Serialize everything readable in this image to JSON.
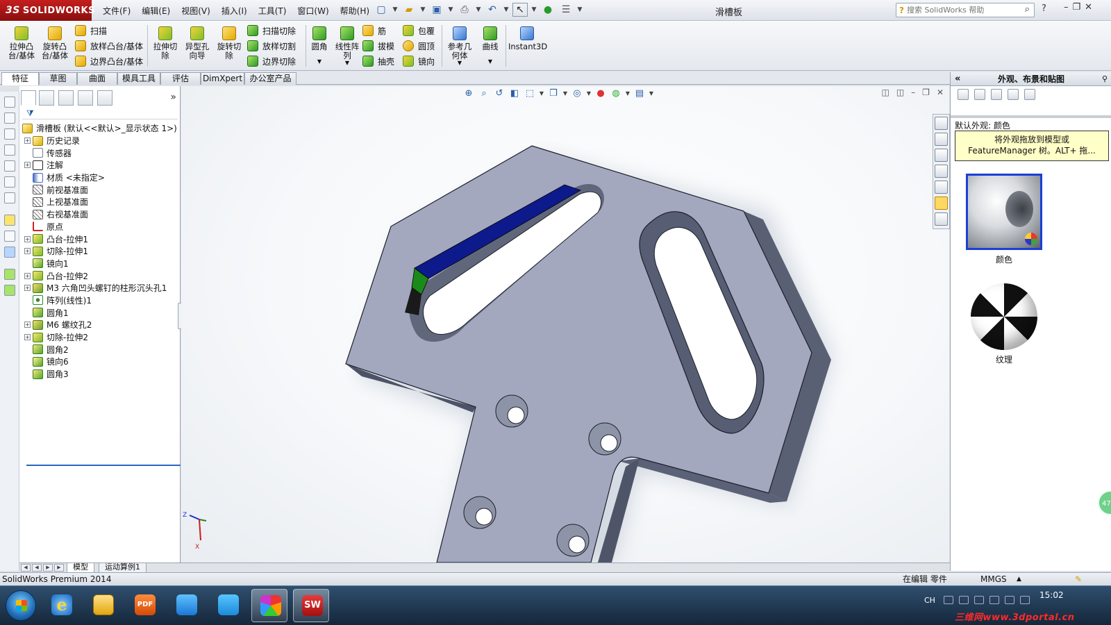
{
  "app": {
    "logo_prefix": "3S",
    "logo_text": "SOLIDWORKS",
    "document_title": "滑槽板"
  },
  "menus": [
    "文件(F)",
    "编辑(E)",
    "视图(V)",
    "插入(I)",
    "工具(T)",
    "窗口(W)",
    "帮助(H)"
  ],
  "search": {
    "placeholder": "搜索 SolidWorks 帮助"
  },
  "command_manager": {
    "big_buttons": [
      {
        "label": "拉伸凸\n台/基体"
      },
      {
        "label": "旋转凸\n台/基体"
      },
      {
        "label": "拉伸切\n除"
      },
      {
        "label": "异型孔\n向导"
      },
      {
        "label": "旋转切\n除"
      },
      {
        "label": "圆角"
      },
      {
        "label": "线性阵\n列"
      },
      {
        "label": "参考几\n何体"
      },
      {
        "label": "曲线"
      },
      {
        "label": "Instant3D"
      }
    ],
    "small_buttons": [
      {
        "label": "扫描"
      },
      {
        "label": "放样凸台/基体"
      },
      {
        "label": "边界凸台/基体"
      },
      {
        "label": "扫描切除"
      },
      {
        "label": "放样切割"
      },
      {
        "label": "边界切除"
      },
      {
        "label": "筋"
      },
      {
        "label": "拔模"
      },
      {
        "label": "抽壳"
      },
      {
        "label": "包覆"
      },
      {
        "label": "圆顶"
      },
      {
        "label": "镜向"
      }
    ]
  },
  "cm_tabs": [
    "特征",
    "草图",
    "曲面",
    "模具工具",
    "评估",
    "DimXpert",
    "办公室产品"
  ],
  "feature_tree": {
    "root": "滑槽板  (默认<<默认>_显示状态 1>)",
    "items": [
      {
        "label": "历史记录",
        "expandable": true
      },
      {
        "label": "传感器",
        "expandable": false
      },
      {
        "label": "注解",
        "expandable": true
      },
      {
        "label": "材质 <未指定>",
        "expandable": false
      },
      {
        "label": "前视基准面",
        "expandable": false
      },
      {
        "label": "上视基准面",
        "expandable": false
      },
      {
        "label": "右视基准面",
        "expandable": false
      },
      {
        "label": "原点",
        "expandable": false
      },
      {
        "label": "凸台-拉伸1",
        "expandable": true
      },
      {
        "label": "切除-拉伸1",
        "expandable": true
      },
      {
        "label": "镜向1",
        "expandable": false
      },
      {
        "label": "凸台-拉伸2",
        "expandable": true
      },
      {
        "label": "M3 六角凹头螺钉的柱形沉头孔1",
        "expandable": true
      },
      {
        "label": "阵列(线性)1",
        "expandable": false
      },
      {
        "label": "圆角1",
        "expandable": false
      },
      {
        "label": "M6 螺纹孔2",
        "expandable": true
      },
      {
        "label": "切除-拉伸2",
        "expandable": true
      },
      {
        "label": "圆角2",
        "expandable": false
      },
      {
        "label": "镜向6",
        "expandable": false
      },
      {
        "label": "圆角3",
        "expandable": false
      }
    ]
  },
  "appearance_pane": {
    "title": "外观、布景和贴图",
    "section_label": "默认外观: 颜色",
    "tooltip": "将外观拖放到模型或\nFeatureManager 树。ALT+ 拖...",
    "swatches": [
      {
        "label": "颜色",
        "selected": true
      },
      {
        "label": "纹理",
        "selected": false
      }
    ]
  },
  "triad": {
    "z": "Z",
    "x": "X"
  },
  "bottom_tabs": [
    "模型",
    "运动算例1"
  ],
  "status": {
    "product": "SolidWorks Premium 2014",
    "mode": "在编辑 零件",
    "units": "MMGS"
  },
  "taskbar": {
    "ime": "CH",
    "clock": "15:02",
    "sw_icon": "SW",
    "pdf_icon": "PDF"
  },
  "watermark": "三维网www.3dportal.cn",
  "edge_badge": "47",
  "colors": {
    "brand_red": "#b01515",
    "selection_blue": "#1a3fd6",
    "face_blue": "#0d1a8c",
    "face_green": "#1a8a1a",
    "part_gray": "#a3a8bf"
  }
}
